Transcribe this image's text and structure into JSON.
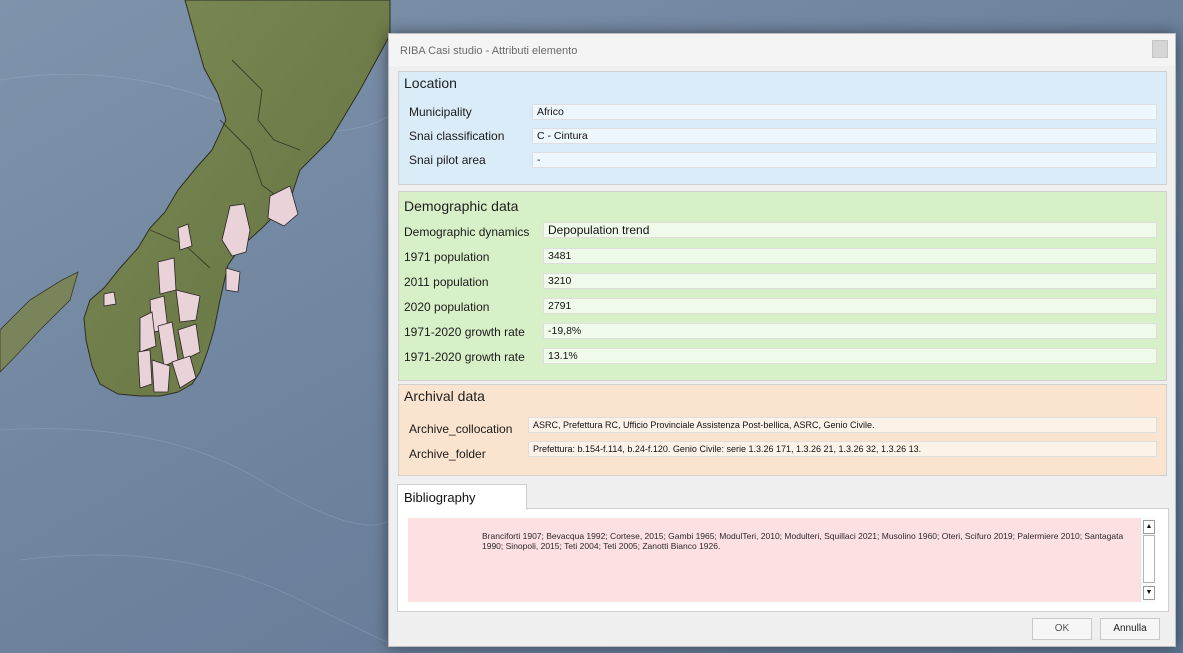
{
  "window": {
    "title": "RIBA Casi studio - Attributi elemento"
  },
  "location": {
    "title": "Location",
    "rows": [
      {
        "label": "Municipality",
        "value": "Africo"
      },
      {
        "label": "Snai classification",
        "value": "C - Cintura"
      },
      {
        "label": "Snai pilot area",
        "value": "-"
      }
    ]
  },
  "demographic": {
    "title": "Demographic data",
    "rows": [
      {
        "label": "Demographic dynamics",
        "value": "Depopulation trend"
      },
      {
        "label": "1971 population",
        "value": "3481"
      },
      {
        "label": "2011 population",
        "value": "3210"
      },
      {
        "label": "2020 population",
        "value": "2791"
      },
      {
        "label": "1971-2020 growth rate",
        "value": "-19,8%"
      },
      {
        "label": "1971-2020 growth rate",
        "value": "13.1%"
      }
    ]
  },
  "archival": {
    "title": "Archival data",
    "rows": [
      {
        "label": "Archive_collocation",
        "value": "ASRC, Prefettura RC, Ufficio Provinciale Assistenza Post-bellica, ASRC, Genio Civile."
      },
      {
        "label": "Archive_folder",
        "value": "Prefettura: b.154-f.114, b.24-f.120. Genio Civile: serie 1.3.26 171, 1.3.26 21, 1.3.26 32, 1.3.26 13."
      }
    ]
  },
  "bibliography": {
    "tab_label": "Bibliography",
    "text": "Branciforti 1907; Bevacqua 1992; Cortese, 2015; Gambi 1965; ModulTeri, 2010; Modulteri, Squillaci 2021; Musolino 1960; Oteri, Scifuro 2019; Palermiere 2010; Santagata 1990; Sinopoli, 2015; Teti 2004; Teti 2005; Zanotti Bianco 1926."
  },
  "buttons": {
    "ok": "OK",
    "cancel": "Annulla"
  },
  "icons": {
    "close": "close-icon",
    "scroll_up": "arrow-up-icon",
    "scroll_down": "arrow-down-icon"
  }
}
